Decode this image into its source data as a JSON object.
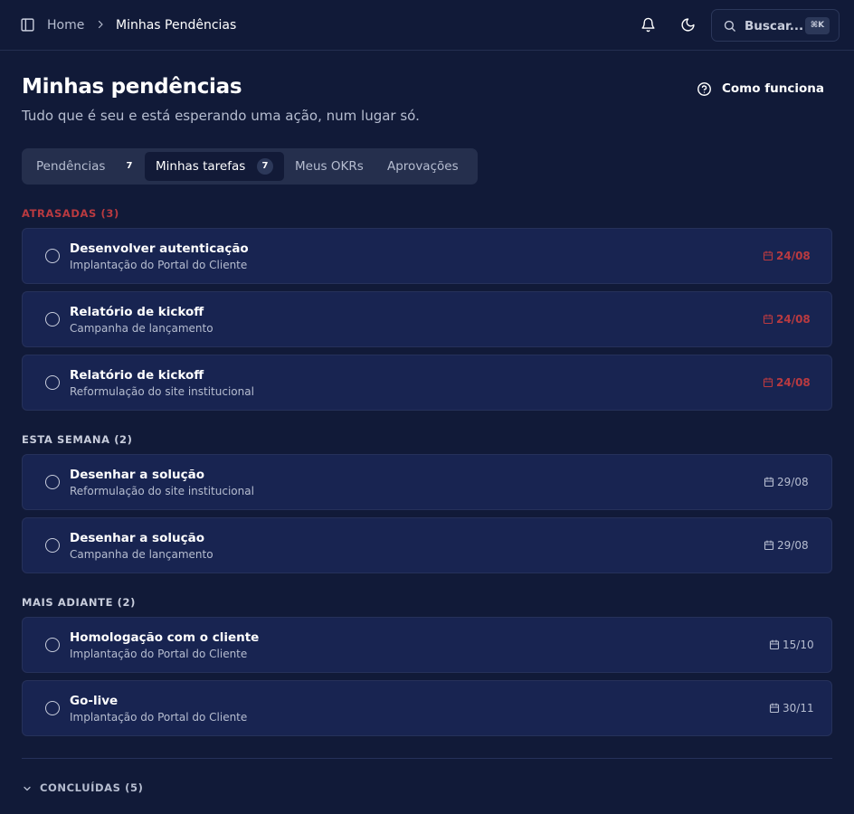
{
  "breadcrumb": {
    "home": "Home",
    "current": "Minhas Pendências"
  },
  "search": {
    "label": "Buscar...",
    "shortcut": "⌘K"
  },
  "page": {
    "title": "Minhas pendências",
    "subtitle": "Tudo que é seu e está esperando uma ação, num lugar só.",
    "help_button": "Como funciona"
  },
  "tabs": [
    {
      "label": "Pendências",
      "count": "7",
      "active": false
    },
    {
      "label": "Minhas tarefas",
      "count": "7",
      "active": true
    },
    {
      "label": "Meus OKRs",
      "active": false
    },
    {
      "label": "Aprovações",
      "active": false
    }
  ],
  "sections": {
    "late": {
      "label": "ATRASADAS (3)",
      "color": "#b93a40",
      "items": [
        {
          "title": "Desenvolver autenticação",
          "project": "Implantação do Portal do Cliente",
          "due": "24/08"
        },
        {
          "title": "Relatório de kickoff",
          "project": "Campanha de lançamento",
          "due": "24/08"
        },
        {
          "title": "Relatório de kickoff",
          "project": "Reformulação do site institucional",
          "due": "24/08"
        }
      ]
    },
    "week": {
      "label": "ESTA SEMANA (2)",
      "items": [
        {
          "title": "Desenhar a solução",
          "project": "Reformulação do site institucional",
          "due": "29/08"
        },
        {
          "title": "Desenhar a solução",
          "project": "Campanha de lançamento",
          "due": "29/08"
        }
      ]
    },
    "later": {
      "label": "MAIS ADIANTE (2)",
      "items": [
        {
          "title": "Homologação com o cliente",
          "project": "Implantação do Portal do Cliente",
          "due": "15/10"
        },
        {
          "title": "Go-live",
          "project": "Implantação do Portal do Cliente",
          "due": "30/11"
        }
      ]
    }
  },
  "completed": {
    "label": "CONCLUÍDAS (5)"
  },
  "icons": {
    "sidebar_toggle": "sidebar-icon",
    "breadcrumb_separator": "chevron-right-icon",
    "notifications": "bell-icon",
    "theme": "moon-icon",
    "search": "search-icon",
    "help": "help-circle-icon",
    "task_status": "circle-icon",
    "due_date": "calendar-icon",
    "collapse": "chevron-down-icon"
  }
}
